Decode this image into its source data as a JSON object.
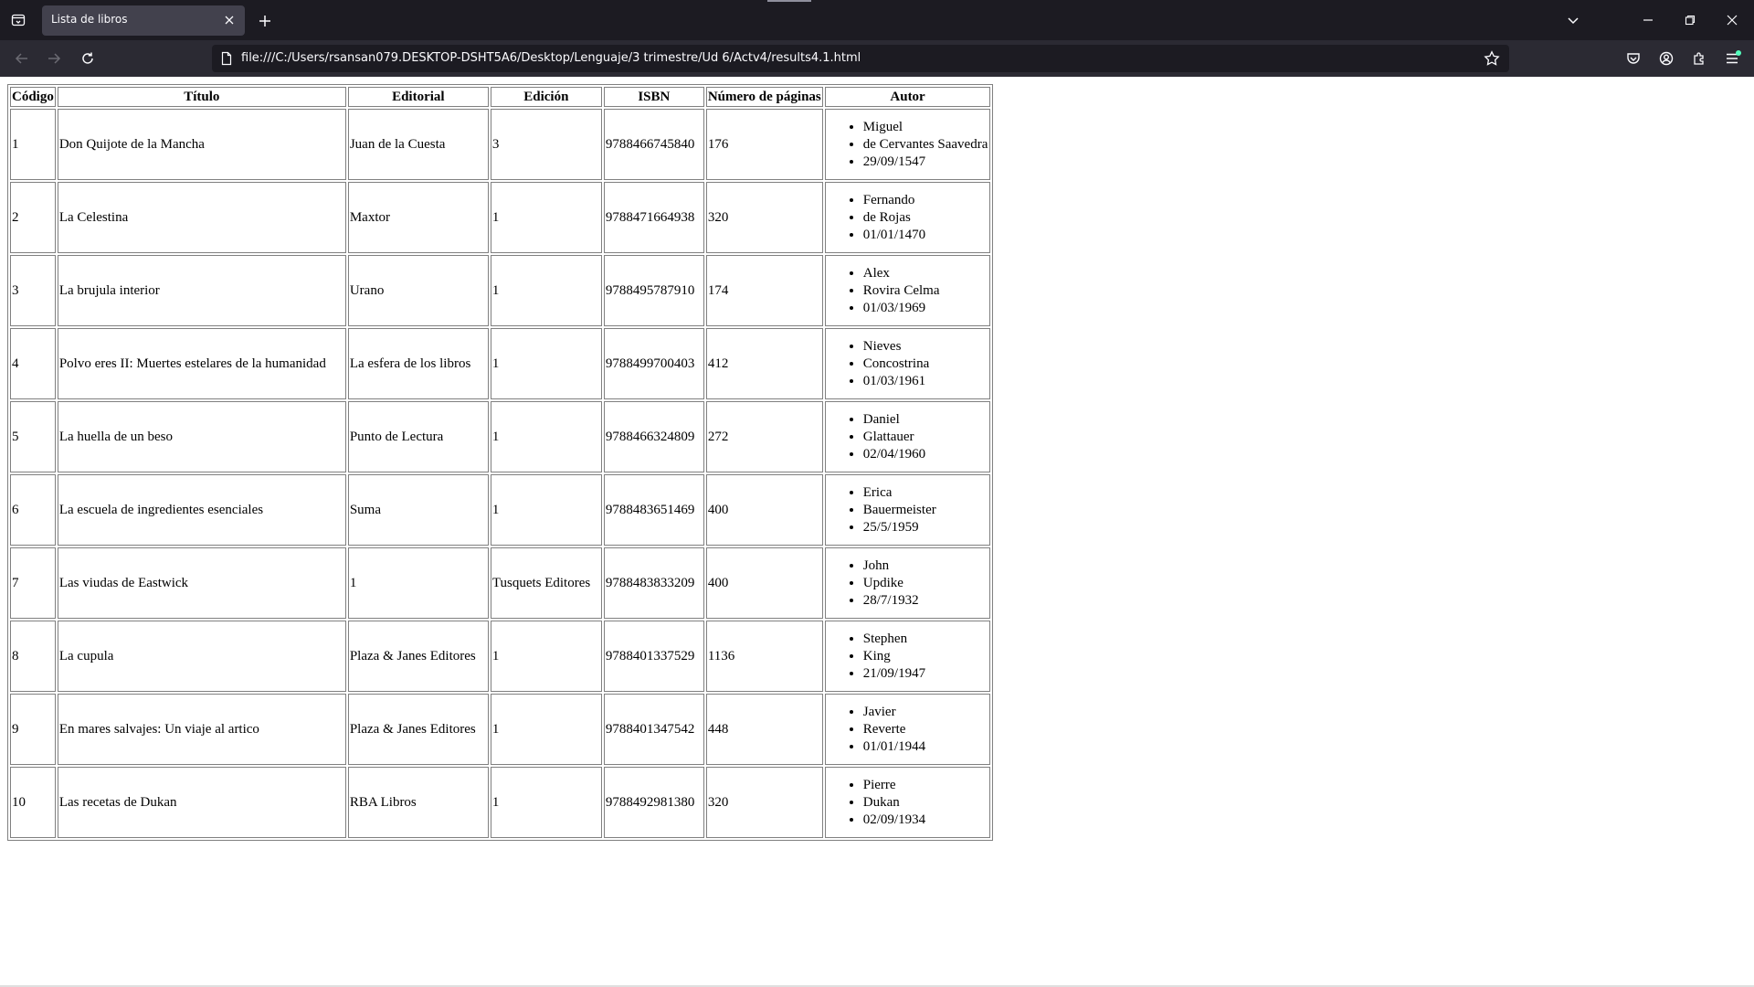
{
  "browser": {
    "tab_title": "Lista de libros",
    "url": "file:///C:/Users/rsansan079.DESKTOP-DSHT5A6/Desktop/Lenguaje/3 trimestre/Ud 6/Actv4/results4.1.html"
  },
  "table": {
    "headers": [
      "Código",
      "Título",
      "Editorial",
      "Edición",
      "ISBN",
      "Número de páginas",
      "Autor"
    ],
    "rows": [
      {
        "codigo": "1",
        "titulo": "Don Quijote de la Mancha",
        "editorial": "Juan de la Cuesta",
        "edicion": "3",
        "isbn": "9788466745840",
        "paginas": "176",
        "autor": [
          "Miguel",
          "de Cervantes Saavedra",
          "29/09/1547"
        ]
      },
      {
        "codigo": "2",
        "titulo": "La Celestina",
        "editorial": "Maxtor",
        "edicion": "1",
        "isbn": "9788471664938",
        "paginas": "320",
        "autor": [
          "Fernando",
          "de Rojas",
          "01/01/1470"
        ]
      },
      {
        "codigo": "3",
        "titulo": "La brujula interior",
        "editorial": "Urano",
        "edicion": "1",
        "isbn": "9788495787910",
        "paginas": "174",
        "autor": [
          "Alex",
          "Rovira Celma",
          "01/03/1969"
        ]
      },
      {
        "codigo": "4",
        "titulo": "Polvo eres II: Muertes estelares de la humanidad",
        "editorial": "La esfera de los libros",
        "edicion": "1",
        "isbn": "9788499700403",
        "paginas": "412",
        "autor": [
          "Nieves",
          "Concostrina",
          "01/03/1961"
        ]
      },
      {
        "codigo": "5",
        "titulo": "La huella de un beso",
        "editorial": "Punto de Lectura",
        "edicion": "1",
        "isbn": "9788466324809",
        "paginas": "272",
        "autor": [
          "Daniel",
          "Glattauer",
          "02/04/1960"
        ]
      },
      {
        "codigo": "6",
        "titulo": "La escuela de ingredientes esenciales",
        "editorial": "Suma",
        "edicion": "1",
        "isbn": "9788483651469",
        "paginas": "400",
        "autor": [
          "Erica",
          "Bauermeister",
          "25/5/1959"
        ]
      },
      {
        "codigo": "7",
        "titulo": "Las viudas de Eastwick",
        "editorial": "1",
        "edicion": "Tusquets Editores",
        "isbn": "9788483833209",
        "paginas": "400",
        "autor": [
          "John",
          "Updike",
          "28/7/1932"
        ]
      },
      {
        "codigo": "8",
        "titulo": "La cupula",
        "editorial": "Plaza & Janes Editores",
        "edicion": "1",
        "isbn": "9788401337529",
        "paginas": "1136",
        "autor": [
          "Stephen",
          "King",
          "21/09/1947"
        ]
      },
      {
        "codigo": "9",
        "titulo": "En mares salvajes: Un viaje al artico",
        "editorial": "Plaza & Janes Editores",
        "edicion": "1",
        "isbn": "9788401347542",
        "paginas": "448",
        "autor": [
          "Javier",
          "Reverte",
          "01/01/1944"
        ]
      },
      {
        "codigo": "10",
        "titulo": "Las recetas de Dukan",
        "editorial": "RBA Libros",
        "edicion": "1",
        "isbn": "9788492981380",
        "paginas": "320",
        "autor": [
          "Pierre",
          "Dukan",
          "02/09/1934"
        ]
      }
    ]
  }
}
